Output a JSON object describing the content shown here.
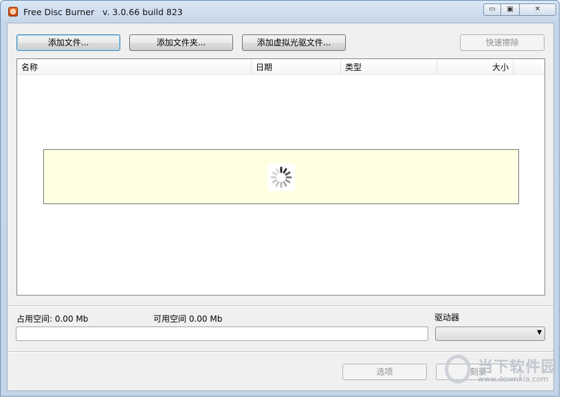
{
  "window": {
    "title": "Free Disc Burner   v. 3.0.66 build 823",
    "controls": {
      "minimize": "▭",
      "maximize": "▣",
      "close": "✕"
    }
  },
  "toolbar": {
    "add_files": "添加文件...",
    "add_folder": "添加文件夹...",
    "add_virtual_drive_files": "添加虚拟光驱文件...",
    "quick_erase": "快速擦除"
  },
  "list": {
    "columns": [
      "名称",
      "日期",
      "类型",
      "大小"
    ],
    "rows": []
  },
  "status": {
    "used_space": "占用空间: 0.00 Mb",
    "free_space": "可用空间 0.00 Mb",
    "drive_label": "驱动器",
    "drive_selected": "",
    "progress": 0
  },
  "footer": {
    "options": "选项",
    "burn": "刻录"
  },
  "watermark": {
    "name": "当下软件园",
    "url": "www.downxia.com"
  },
  "colors": {
    "loading_bg": "#ffffe1",
    "titlebar": "#c5d6ea",
    "client_bg": "#f0f0f0",
    "focus_border": "#3c7fb1"
  },
  "icons": {
    "app": "disc-burner-icon",
    "loading": "spinner-icon",
    "dropdown": "chevron-down-icon"
  }
}
